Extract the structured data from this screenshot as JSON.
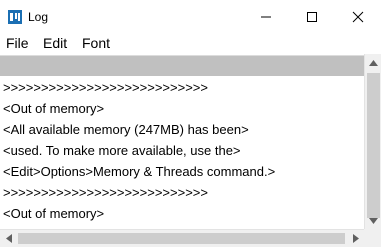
{
  "window": {
    "title": "Log"
  },
  "menu": {
    "file": "File",
    "edit": "Edit",
    "font": "Font"
  },
  "log_lines": [
    ">>>>>>>>>>>>>>>>>>>>>>>>>>>",
    "<Out of memory>",
    "<All available memory (247MB) has been>",
    "<used. To make more available, use the>",
    "<Edit>Options>Memory & Threads command.>",
    ">>>>>>>>>>>>>>>>>>>>>>>>>>>",
    "<Out of memory>"
  ],
  "colors": {
    "toolbar_gray": "#c0c0c0",
    "scrollbar": "#f0f0f0",
    "icon_blue": "#1b6fb3"
  },
  "icons": {
    "app": "app-icon",
    "minimize": "minimize-icon",
    "maximize": "maximize-icon",
    "close": "close-icon"
  }
}
